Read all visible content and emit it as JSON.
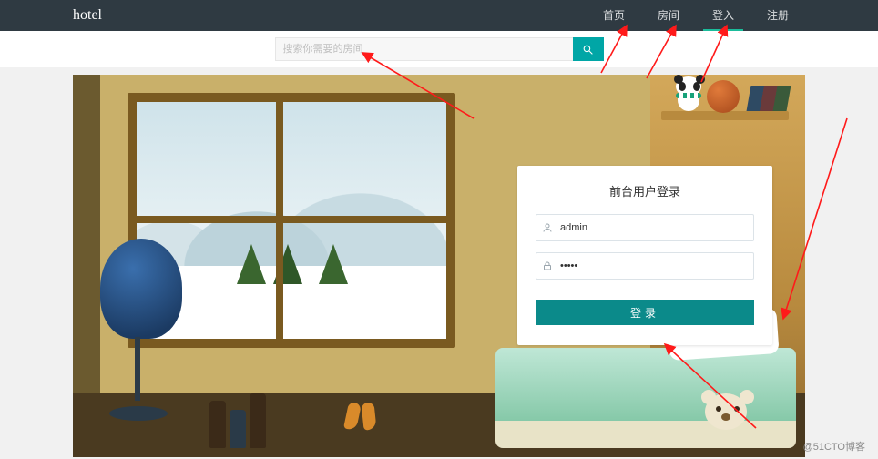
{
  "header": {
    "brand": "hotel",
    "nav": [
      {
        "id": "home",
        "label": "首页"
      },
      {
        "id": "rooms",
        "label": "房间"
      },
      {
        "id": "login",
        "label": "登入",
        "active": true
      },
      {
        "id": "register",
        "label": "注册"
      }
    ]
  },
  "search": {
    "placeholder": "搜索你需要的房间"
  },
  "login_panel": {
    "title": "前台用户登录",
    "username_value": "admin",
    "password_value": "•••••",
    "submit_label": "登录"
  },
  "icons": {
    "search": "search-icon",
    "user": "user-icon",
    "lock": "lock-icon"
  },
  "watermark": "@51CTO博客",
  "colors": {
    "nav_bg": "#2f3a42",
    "accent": "#00a6a6",
    "login_btn": "#0b8a8a",
    "annotation": "#ff1a1a"
  }
}
